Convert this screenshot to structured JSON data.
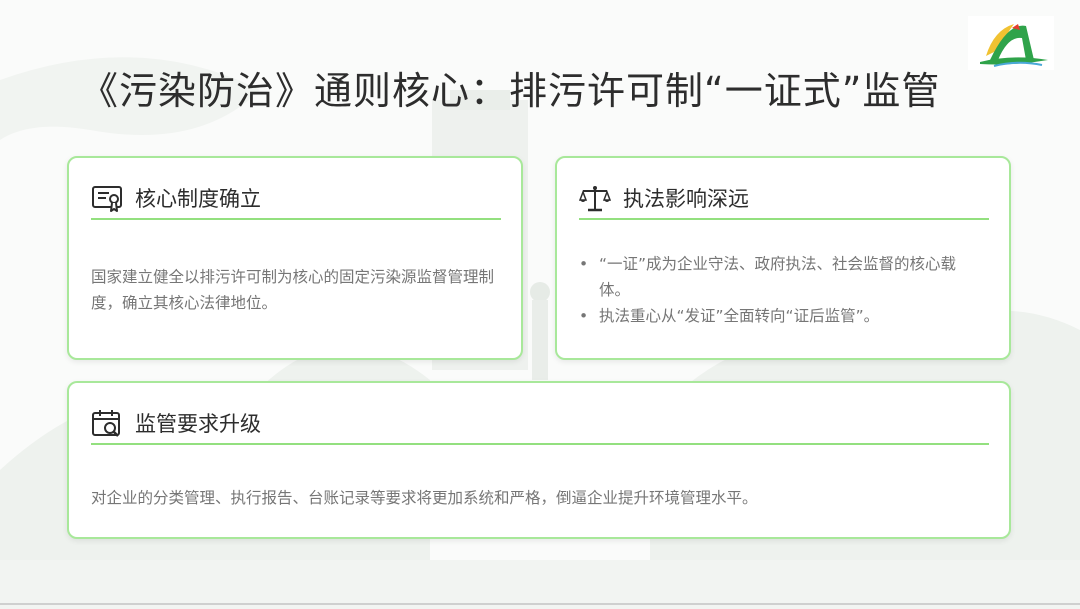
{
  "title": "《污染防治》通则核心：排污许可制“一证式”监管",
  "logo": {
    "icon": "a-letter-logo",
    "colors": [
      "#2fa34a",
      "#f1c232",
      "#e63c2f",
      "#4aa8d8"
    ]
  },
  "cards": [
    {
      "icon": "certificate-icon",
      "title": "核心制度确立",
      "body": "国家建立健全以排污许可制为核心的固定污染源监督管理制度，确立其核心法律地位。"
    },
    {
      "icon": "scales-icon",
      "title": "执法影响深远",
      "bullets": [
        "“一证”成为企业守法、政府执法、社会监督的核心载体。",
        "执法重心从“发证”全面转向“证后监管”。"
      ]
    },
    {
      "icon": "calendar-search-icon",
      "title": "监管要求升级",
      "body": "对企业的分类管理、执行报告、台账记录等要求将更加系统和严格，倒逼企业提升环境管理水平。"
    }
  ],
  "colors": {
    "accent": "#93e07f",
    "border": "#a8e89a",
    "text": "#2d2d2d",
    "muted": "#767676"
  }
}
